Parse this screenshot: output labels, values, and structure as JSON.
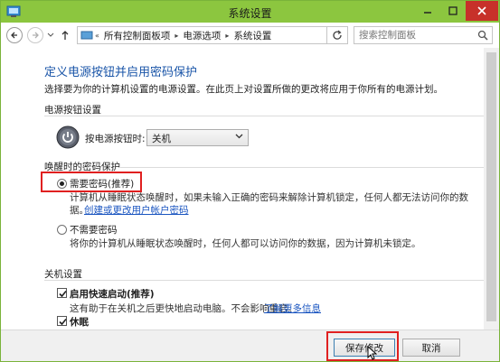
{
  "window": {
    "title": "系统设置"
  },
  "address": {
    "crumbs": [
      "所有控制面板项",
      "电源选项",
      "系统设置"
    ],
    "search_placeholder": "搜索控制面板"
  },
  "page": {
    "heading": "定义电源按钮并启用密码保护",
    "description": "选择要为你的计算机设置的电源设置。在此页上对设置所做的更改将应用于你所有的电源计划。"
  },
  "power_buttons": {
    "section_label": "电源按钮设置",
    "label": "按电源按钮时:",
    "selected": "关机"
  },
  "wake_password": {
    "section_label": "唤醒时的密码保护",
    "require": {
      "label": "需要密码(推荐)",
      "checked": true,
      "desc_line1": "计算机从睡眠状态唤醒时，如果未输入正确的密码来解除计算机锁定，任何人都无法访问你的数",
      "desc_line2": "据。",
      "link": "创建或更改用户帐户密码"
    },
    "no_require": {
      "label": "不需要密码",
      "checked": false,
      "desc": "将你的计算机从睡眠状态唤醒时，任何人都可以访问你的数据，因为计算机未锁定。"
    }
  },
  "shutdown": {
    "section_label": "关机设置",
    "fast_startup": {
      "label": "启用快速启动(推荐)",
      "checked": true,
      "desc": "这有助于在关机之后更快地启动电脑。不会影响重启。",
      "link": "了解更多信息"
    },
    "hibernate": {
      "label": "休眠",
      "checked": true
    }
  },
  "footer": {
    "save_label": "保存修改",
    "cancel_label": "取消"
  },
  "colors": {
    "titlebar": "#8cc63f",
    "heading": "#1a55a8",
    "link": "#1a55c0",
    "highlight": "#e02020",
    "close": "#c7312a"
  }
}
